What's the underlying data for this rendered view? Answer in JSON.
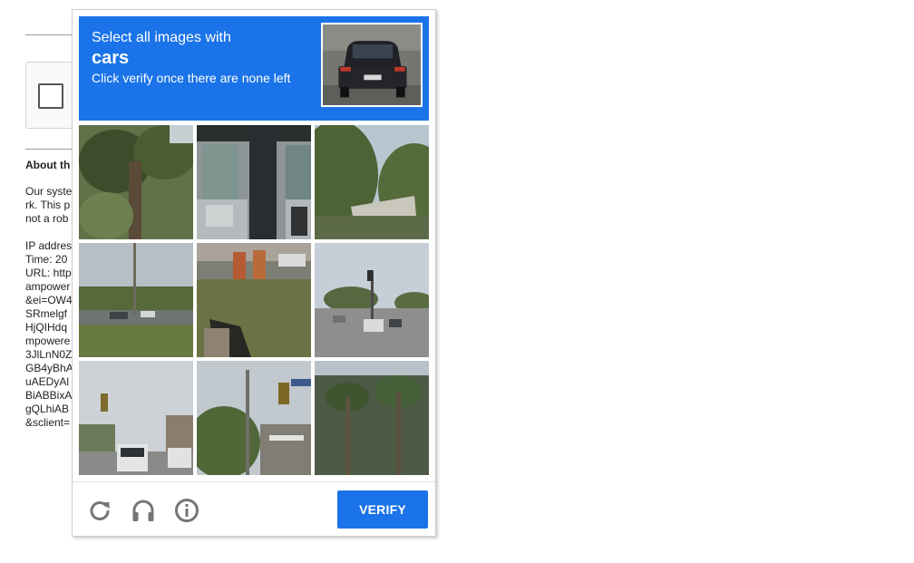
{
  "background_page": {
    "heading": "About th",
    "para1": [
      "Our syste",
      "rk. This p",
      "not a rob"
    ],
    "para2": [
      "IP addres",
      "Time: 20",
      "URL: http",
      "ampower",
      "&ei=OW4",
      "SRmelgf",
      "HjQIHdq",
      "mpowere",
      "3JlLnN0Z",
      "GB4yBhA",
      "uAEDyAl",
      "BiABBixA",
      "gQLhiAB",
      "&sclient="
    ]
  },
  "captcha": {
    "instruction_line1": "Select all images with",
    "target": "cars",
    "instruction_line3": "Click verify once there are none left",
    "sample_image": "rear view of dark car on street",
    "tiles": [
      {
        "description": "palm tree foliage"
      },
      {
        "description": "building doorway and pole"
      },
      {
        "description": "trees and awning"
      },
      {
        "description": "road with trees and cars"
      },
      {
        "description": "grass and construction barrels"
      },
      {
        "description": "street intersection with cars"
      },
      {
        "description": "street with traffic light and truck"
      },
      {
        "description": "utility pole and traffic light"
      },
      {
        "description": "palm trees by building"
      }
    ],
    "buttons": {
      "reload_icon": "reload-icon",
      "audio_icon": "headphones-icon",
      "info_icon": "info-icon",
      "verify_label": "VERIFY"
    },
    "colors": {
      "accent": "#1a73e8",
      "icon": "#757575"
    }
  }
}
